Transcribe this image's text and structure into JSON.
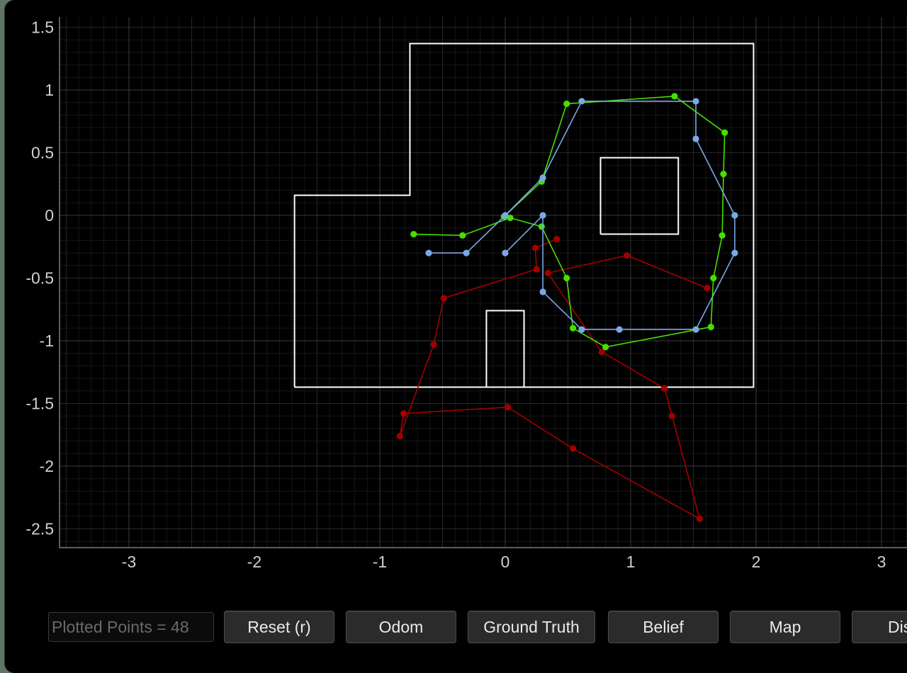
{
  "toolbar": {
    "plotted_points": "Plotted Points = 48",
    "buttons": [
      "Reset (r)",
      "Odom",
      "Ground Truth",
      "Belief",
      "Map",
      "Dis"
    ]
  },
  "chart_data": {
    "type": "scatter",
    "title": "",
    "xlabel": "",
    "ylabel": "",
    "xlim": [
      -3.6,
      3.2
    ],
    "ylim": [
      -2.75,
      1.6
    ],
    "grid": true,
    "xticks": [
      -3,
      -2,
      -1,
      0,
      1,
      2,
      3
    ],
    "xtick_labels": [
      "-3",
      "-2",
      "-1",
      "0",
      "1",
      "2",
      "3"
    ],
    "yticks": [
      1.5,
      1,
      0.5,
      0,
      -0.5,
      -1,
      -1.5,
      -2,
      -2.5
    ],
    "ytick_labels": [
      "1.5",
      "1",
      "0.5",
      "0",
      "-0.5",
      "-1",
      "-1.5",
      "-2",
      "-2.5"
    ],
    "map_polygons": [
      {
        "color": "#ffffff",
        "points": [
          [
            -1.68,
            -1.37
          ],
          [
            1.98,
            -1.37
          ],
          [
            1.98,
            1.37
          ],
          [
            -0.76,
            1.37
          ],
          [
            -0.76,
            0.16
          ],
          [
            -1.68,
            0.16
          ],
          [
            -1.68,
            -1.37
          ]
        ]
      },
      {
        "color": "#ffffff",
        "points": [
          [
            0.76,
            -0.15
          ],
          [
            1.38,
            -0.15
          ],
          [
            1.38,
            0.46
          ],
          [
            0.76,
            0.46
          ],
          [
            0.76,
            -0.15
          ]
        ]
      },
      {
        "color": "#ffffff",
        "points": [
          [
            -0.15,
            -1.37
          ],
          [
            0.15,
            -1.37
          ],
          [
            0.15,
            -0.76
          ],
          [
            -0.15,
            -0.76
          ],
          [
            -0.15,
            -1.37
          ]
        ]
      }
    ],
    "series": [
      {
        "color": "#a00000",
        "points": [
          [
            0.41,
            -0.19
          ],
          [
            0.24,
            -0.26
          ],
          [
            0.25,
            -0.43
          ],
          [
            -0.49,
            -0.66
          ],
          [
            -0.57,
            -1.03
          ],
          [
            -0.84,
            -1.76
          ],
          [
            -0.81,
            -1.58
          ],
          [
            0.02,
            -1.53
          ],
          [
            0.54,
            -1.86
          ],
          [
            1.55,
            -2.42
          ],
          [
            1.33,
            -1.6
          ],
          [
            1.27,
            -1.38
          ],
          [
            0.77,
            -1.09
          ],
          [
            0.34,
            -0.46
          ],
          [
            0.97,
            -0.32
          ],
          [
            1.61,
            -0.58
          ]
        ]
      },
      {
        "color": "#44e000",
        "points": [
          [
            -0.73,
            -0.15
          ],
          [
            -0.34,
            -0.16
          ],
          [
            0.04,
            -0.02
          ],
          [
            0.29,
            -0.09
          ],
          [
            0.49,
            -0.5
          ],
          [
            0.54,
            -0.9
          ],
          [
            0.8,
            -1.05
          ],
          [
            1.64,
            -0.89
          ],
          [
            1.66,
            -0.5
          ],
          [
            1.73,
            -0.16
          ],
          [
            1.74,
            0.33
          ],
          [
            1.75,
            0.66
          ],
          [
            1.35,
            0.95
          ],
          [
            0.49,
            0.89
          ],
          [
            0.29,
            0.27
          ],
          [
            -0.01,
            -0.01
          ]
        ]
      },
      {
        "color": "#7ba8e8",
        "points": [
          [
            -0.61,
            -0.3
          ],
          [
            -0.31,
            -0.3
          ],
          [
            0.0,
            0.0
          ],
          [
            0.3,
            0.3
          ],
          [
            0.61,
            0.91
          ],
          [
            1.52,
            0.91
          ],
          [
            1.52,
            0.61
          ],
          [
            1.83,
            0.0
          ],
          [
            1.83,
            -0.3
          ],
          [
            1.52,
            -0.91
          ],
          [
            0.91,
            -0.91
          ],
          [
            0.61,
            -0.91
          ],
          [
            0.3,
            -0.61
          ],
          [
            0.3,
            0.0
          ],
          [
            0.0,
            -0.3
          ]
        ]
      }
    ]
  }
}
